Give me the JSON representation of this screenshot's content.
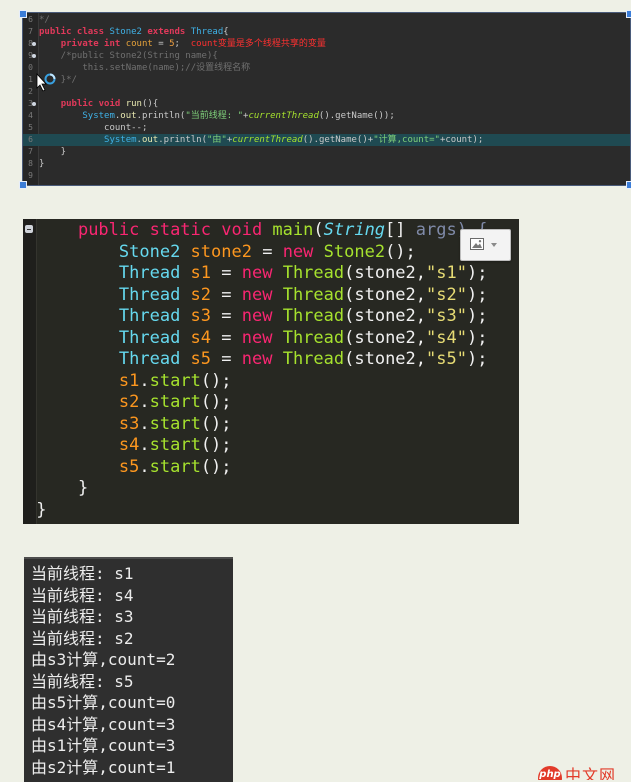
{
  "editor_small": {
    "rows": [
      {
        "n": "6",
        "segs": [
          [
            "cmt",
            "*/"
          ]
        ]
      },
      {
        "n": "7",
        "segs": [
          [
            "kw",
            "public class "
          ],
          [
            "cls",
            "Stone2 "
          ],
          [
            "kw",
            "extends "
          ],
          [
            "cls",
            "Thread"
          ],
          [
            "plain",
            "{"
          ]
        ]
      },
      {
        "n": "8",
        "segs": [
          [
            "plain",
            "    "
          ],
          [
            "kw",
            "private int "
          ],
          [
            "var1",
            "count"
          ],
          [
            "plain",
            " = "
          ],
          [
            "num",
            "5"
          ],
          [
            "plain",
            ";  "
          ],
          [
            "red",
            "count变量是多个线程共享的变量"
          ]
        ]
      },
      {
        "n": "9",
        "segs": [
          [
            "cmt",
            "    /*public Stone2(String name){"
          ]
        ]
      },
      {
        "n": "0",
        "segs": [
          [
            "cmt",
            "        this.setName(name);//设置线程名称"
          ]
        ]
      },
      {
        "n": "1",
        "segs": [
          [
            "cmt",
            "    }*/"
          ]
        ]
      },
      {
        "n": "2",
        "segs": []
      },
      {
        "n": "3",
        "segs": [
          [
            "plain",
            "    "
          ],
          [
            "kw",
            "public void "
          ],
          [
            "fn",
            "run"
          ],
          [
            "plain",
            "(){"
          ]
        ]
      },
      {
        "n": "4",
        "segs": [
          [
            "plain",
            "        "
          ],
          [
            "cls",
            "System"
          ],
          [
            "plain",
            "."
          ],
          [
            "fn",
            "out"
          ],
          [
            "plain",
            ".println("
          ],
          [
            "str",
            "\"当前线程: \""
          ],
          [
            "plain",
            "+"
          ],
          [
            "it",
            "currentThread"
          ],
          [
            "plain",
            "().getName());"
          ]
        ]
      },
      {
        "n": "5",
        "segs": [
          [
            "plain",
            "            count--;"
          ]
        ]
      },
      {
        "n": "6",
        "segs": [
          [
            "plain",
            "            "
          ],
          [
            "cls",
            "System"
          ],
          [
            "plain",
            "."
          ],
          [
            "fn",
            "out"
          ],
          [
            "plain",
            ".println("
          ],
          [
            "str",
            "\"由\""
          ],
          [
            "plain",
            "+"
          ],
          [
            "it",
            "currentThread"
          ],
          [
            "plain",
            "().getName()+"
          ],
          [
            "str",
            "\"计算,count=\""
          ],
          [
            "plain",
            "+count);"
          ]
        ]
      },
      {
        "n": "7",
        "segs": [
          [
            "plain",
            "    }"
          ]
        ]
      },
      {
        "n": "8",
        "segs": [
          [
            "plain",
            "}"
          ]
        ]
      },
      {
        "n": "9",
        "segs": []
      }
    ]
  },
  "editor_big": {
    "rows": [
      {
        "segs": [
          [
            "plain",
            "    "
          ],
          [
            "kw",
            "public static void "
          ],
          [
            "grn",
            "main"
          ],
          [
            "plain",
            "("
          ],
          [
            "cls2i",
            "String"
          ],
          [
            "plain",
            "[] "
          ],
          [
            "dim",
            "args) {"
          ]
        ]
      },
      {
        "segs": [
          [
            "plain",
            "        "
          ],
          [
            "cls2",
            "Stone2 "
          ],
          [
            "var2",
            "stone2"
          ],
          [
            "plain",
            " = "
          ],
          [
            "kw",
            "new "
          ],
          [
            "grn",
            "Stone2"
          ],
          [
            "plain",
            "();"
          ]
        ]
      },
      {
        "segs": [
          [
            "plain",
            "        "
          ],
          [
            "cls2",
            "Thread "
          ],
          [
            "var2",
            "s1"
          ],
          [
            "plain",
            " = "
          ],
          [
            "kw",
            "new "
          ],
          [
            "grn",
            "Thread"
          ],
          [
            "plain",
            "(stone2,"
          ],
          [
            "str2",
            "\"s1\""
          ],
          [
            "plain",
            ");"
          ]
        ]
      },
      {
        "segs": [
          [
            "plain",
            "        "
          ],
          [
            "cls2",
            "Thread "
          ],
          [
            "var2",
            "s2"
          ],
          [
            "plain",
            " = "
          ],
          [
            "kw",
            "new "
          ],
          [
            "grn",
            "Thread"
          ],
          [
            "plain",
            "(stone2,"
          ],
          [
            "str2",
            "\"s2\""
          ],
          [
            "plain",
            ");"
          ]
        ]
      },
      {
        "segs": [
          [
            "plain",
            "        "
          ],
          [
            "cls2",
            "Thread "
          ],
          [
            "var2",
            "s3"
          ],
          [
            "plain",
            " = "
          ],
          [
            "kw",
            "new "
          ],
          [
            "grn",
            "Thread"
          ],
          [
            "plain",
            "(stone2,"
          ],
          [
            "str2",
            "\"s3\""
          ],
          [
            "plain",
            ");"
          ]
        ]
      },
      {
        "segs": [
          [
            "plain",
            "        "
          ],
          [
            "cls2",
            "Thread "
          ],
          [
            "var2",
            "s4"
          ],
          [
            "plain",
            " = "
          ],
          [
            "kw",
            "new "
          ],
          [
            "grn",
            "Thread"
          ],
          [
            "plain",
            "(stone2,"
          ],
          [
            "str2",
            "\"s4\""
          ],
          [
            "plain",
            ");"
          ]
        ]
      },
      {
        "segs": [
          [
            "plain",
            "        "
          ],
          [
            "cls2",
            "Thread "
          ],
          [
            "var2",
            "s5"
          ],
          [
            "plain",
            " = "
          ],
          [
            "kw",
            "new "
          ],
          [
            "grn",
            "Thread"
          ],
          [
            "plain",
            "(stone2,"
          ],
          [
            "str2",
            "\"s5\""
          ],
          [
            "plain",
            ");"
          ]
        ]
      },
      {
        "segs": [
          [
            "plain",
            "        "
          ],
          [
            "var2",
            "s1"
          ],
          [
            "plain",
            "."
          ],
          [
            "grn",
            "start"
          ],
          [
            "plain",
            "();"
          ]
        ]
      },
      {
        "segs": [
          [
            "plain",
            "        "
          ],
          [
            "var2",
            "s2"
          ],
          [
            "plain",
            "."
          ],
          [
            "grn",
            "start"
          ],
          [
            "plain",
            "();"
          ]
        ]
      },
      {
        "segs": [
          [
            "plain",
            "        "
          ],
          [
            "var2",
            "s3"
          ],
          [
            "plain",
            "."
          ],
          [
            "grn",
            "start"
          ],
          [
            "plain",
            "();"
          ]
        ]
      },
      {
        "segs": [
          [
            "plain",
            "        "
          ],
          [
            "var2",
            "s4"
          ],
          [
            "plain",
            "."
          ],
          [
            "grn",
            "start"
          ],
          [
            "plain",
            "();"
          ]
        ]
      },
      {
        "segs": [
          [
            "plain",
            "        "
          ],
          [
            "var2",
            "s5"
          ],
          [
            "plain",
            "."
          ],
          [
            "grn",
            "start"
          ],
          [
            "plain",
            "();"
          ]
        ]
      },
      {
        "segs": [
          [
            "plain",
            "    }"
          ]
        ]
      },
      {
        "segs": [
          [
            "plain",
            " }"
          ]
        ]
      }
    ]
  },
  "console": {
    "lines": [
      "当前线程: s1",
      "当前线程: s4",
      "当前线程: s3",
      "当前线程: s2",
      "由s3计算,count=2",
      "当前线程: s5",
      "由s5计算,count=0",
      "由s4计算,count=3",
      "由s1计算,count=3",
      "由s2计算,count=1"
    ]
  },
  "watermark": {
    "badge": "php",
    "text": "中文网"
  },
  "icons": {
    "image_tool": "image-icon",
    "cursor": "busy-cursor-icon"
  }
}
